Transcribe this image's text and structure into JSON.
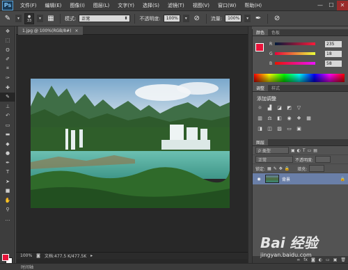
{
  "app": {
    "logo": "Ps"
  },
  "menu": [
    "文件(F)",
    "编辑(E)",
    "图像(I)",
    "图层(L)",
    "文字(Y)",
    "选择(S)",
    "滤镜(T)",
    "视图(V)",
    "窗口(W)",
    "帮助(H)"
  ],
  "window_controls": [
    "—",
    "☐",
    "✕"
  ],
  "options": {
    "brush_size": "33",
    "mode_label": "模式:",
    "mode_value": "正常",
    "opacity_label": "不透明度:",
    "opacity_value": "100%",
    "flow_label": "流量:",
    "flow_value": "100%"
  },
  "document": {
    "tab_title": "1.jpg @ 100%(RGB/8#)",
    "tab_close": "×"
  },
  "status": {
    "zoom": "100%",
    "doc_size": "文档:477.5 K/477.5K"
  },
  "bottom": {
    "label": "时间轴"
  },
  "colors": {
    "foreground": "#e8133a",
    "background": "#ffffff"
  },
  "color_panel": {
    "tabs": [
      "颜色",
      "色板"
    ],
    "channels": [
      {
        "label": "R",
        "value": "235"
      },
      {
        "label": "G",
        "value": "18"
      },
      {
        "label": "B",
        "value": "58"
      }
    ]
  },
  "adjust_panel": {
    "tabs": [
      "调整",
      "样式"
    ],
    "title": "添加调整"
  },
  "layers_panel": {
    "tabs": [
      "图层"
    ],
    "filter_label": "类型",
    "blend_mode": "正常",
    "opacity_label": "不透明度:",
    "lock_label": "锁定:",
    "fill_label": "填充:",
    "layer_name": "背景"
  },
  "watermark": {
    "brand": "Bai 经验",
    "url": "jingyan.baidu.com"
  }
}
